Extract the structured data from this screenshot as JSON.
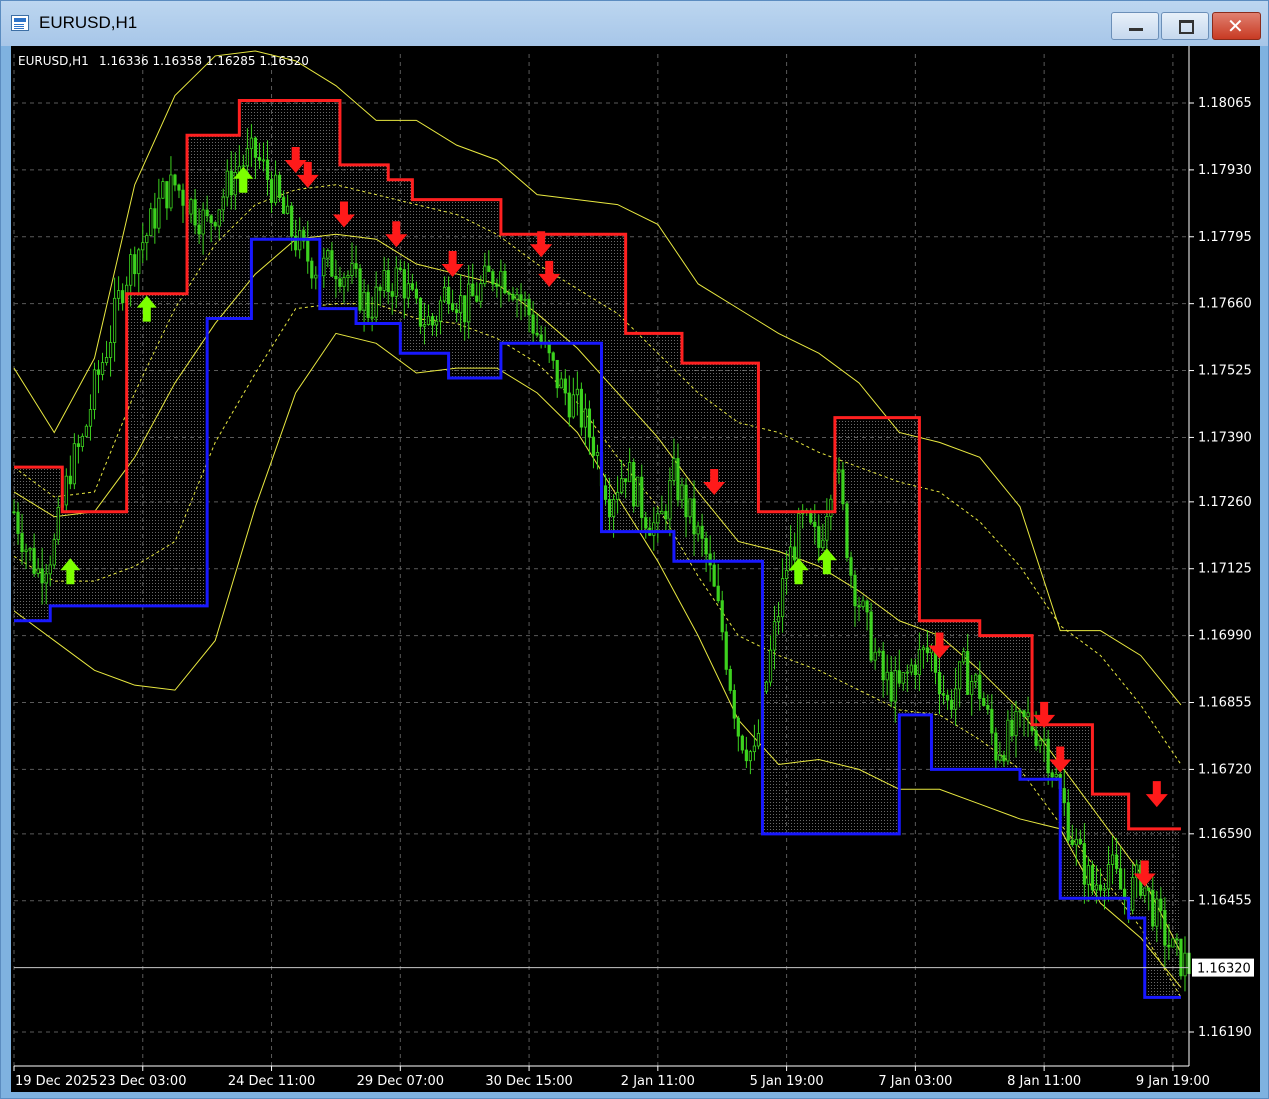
{
  "window": {
    "title": "EURUSD,H1",
    "icons": {
      "app": "chart-app-icon",
      "minimize": "minimize-icon",
      "maximize": "maximize-icon",
      "close": "close-icon"
    }
  },
  "chart_data": {
    "type": "candlestick",
    "symbol_label": "EURUSD,H1",
    "ohlc_label": "1.16336 1.16358 1.16285 1.16320",
    "ohlc": {
      "open": 1.16336,
      "high": 1.16358,
      "low": 1.16285,
      "close": 1.1632
    },
    "current_price": 1.1632,
    "current_price_label": "1.16320",
    "ylim": [
      1.16125,
      1.1817
    ],
    "y_ticks": [
      {
        "value": 1.18065,
        "label": "1.18065"
      },
      {
        "value": 1.1793,
        "label": "1.17930"
      },
      {
        "value": 1.17795,
        "label": "1.17795"
      },
      {
        "value": 1.1766,
        "label": "1.17660"
      },
      {
        "value": 1.17525,
        "label": "1.17525"
      },
      {
        "value": 1.1739,
        "label": "1.17390"
      },
      {
        "value": 1.1726,
        "label": "1.17260"
      },
      {
        "value": 1.17125,
        "label": "1.17125"
      },
      {
        "value": 1.1699,
        "label": "1.16990"
      },
      {
        "value": 1.16855,
        "label": "1.16855"
      },
      {
        "value": 1.1672,
        "label": "1.16720"
      },
      {
        "value": 1.1659,
        "label": "1.16590"
      },
      {
        "value": 1.16455,
        "label": "1.16455"
      },
      {
        "value": 1.1619,
        "label": "1.16190"
      }
    ],
    "x_ticks": [
      {
        "index": 0,
        "label": "19 Dec 2025"
      },
      {
        "index": 32,
        "label": "23 Dec 03:00"
      },
      {
        "index": 64,
        "label": "24 Dec 11:00"
      },
      {
        "index": 96,
        "label": "29 Dec 07:00"
      },
      {
        "index": 128,
        "label": "30 Dec 15:00"
      },
      {
        "index": 160,
        "label": "2 Jan 11:00"
      },
      {
        "index": 192,
        "label": "5 Jan 19:00"
      },
      {
        "index": 224,
        "label": "7 Jan 03:00"
      },
      {
        "index": 256,
        "label": "8 Jan 11:00"
      },
      {
        "index": 288,
        "label": "9 Jan 19:00"
      }
    ],
    "x_range": [
      0,
      292
    ],
    "grid": true,
    "colors": {
      "background": "#000000",
      "grid": "#5a5a5a",
      "candles": "#3cd21e",
      "upper_channel": "#ff2020",
      "lower_channel": "#1818ff",
      "bands": "#e8e840",
      "buy_arrow": "#7cff00",
      "sell_arrow": "#ff1a1a",
      "axis_text": "#ffffff"
    },
    "close_path": [
      [
        0,
        1.1724
      ],
      [
        3,
        1.1717
      ],
      [
        6,
        1.1712
      ],
      [
        10,
        1.1717
      ],
      [
        14,
        1.1733
      ],
      [
        17,
        1.1738
      ],
      [
        20,
        1.1749
      ],
      [
        24,
        1.176
      ],
      [
        27,
        1.177
      ],
      [
        30,
        1.1776
      ],
      [
        33,
        1.178
      ],
      [
        37,
        1.1788
      ],
      [
        40,
        1.179
      ],
      [
        44,
        1.1786
      ],
      [
        48,
        1.1782
      ],
      [
        52,
        1.1788
      ],
      [
        56,
        1.1794
      ],
      [
        60,
        1.1796
      ],
      [
        64,
        1.179
      ],
      [
        68,
        1.1782
      ],
      [
        72,
        1.1776
      ],
      [
        76,
        1.1773
      ],
      [
        80,
        1.1774
      ],
      [
        84,
        1.1771
      ],
      [
        88,
        1.1765
      ],
      [
        92,
        1.1769
      ],
      [
        96,
        1.1772
      ],
      [
        100,
        1.1764
      ],
      [
        104,
        1.1762
      ],
      [
        108,
        1.177
      ],
      [
        112,
        1.1765
      ],
      [
        116,
        1.1769
      ],
      [
        120,
        1.1773
      ],
      [
        124,
        1.177
      ],
      [
        128,
        1.1764
      ],
      [
        132,
        1.1756
      ],
      [
        136,
        1.1749
      ],
      [
        140,
        1.1745
      ],
      [
        144,
        1.1738
      ],
      [
        148,
        1.1727
      ],
      [
        152,
        1.1733
      ],
      [
        156,
        1.1725
      ],
      [
        160,
        1.172
      ],
      [
        164,
        1.1731
      ],
      [
        168,
        1.1723
      ],
      [
        172,
        1.1715
      ],
      [
        176,
        1.17
      ],
      [
        180,
        1.168
      ],
      [
        184,
        1.1674
      ],
      [
        188,
        1.1695
      ],
      [
        192,
        1.1713
      ],
      [
        196,
        1.1722
      ],
      [
        200,
        1.1717
      ],
      [
        204,
        1.1735
      ],
      [
        208,
        1.1712
      ],
      [
        212,
        1.17
      ],
      [
        216,
        1.169
      ],
      [
        220,
        1.1688
      ],
      [
        224,
        1.1694
      ],
      [
        228,
        1.1696
      ],
      [
        232,
        1.1685
      ],
      [
        236,
        1.1692
      ],
      [
        240,
        1.1688
      ],
      [
        244,
        1.1676
      ],
      [
        248,
        1.1679
      ],
      [
        252,
        1.1682
      ],
      [
        256,
        1.1678
      ],
      [
        260,
        1.1667
      ],
      [
        264,
        1.1656
      ],
      [
        268,
        1.1648
      ],
      [
        272,
        1.1653
      ],
      [
        276,
        1.1646
      ],
      [
        280,
        1.165
      ],
      [
        284,
        1.1642
      ],
      [
        288,
        1.1635
      ],
      [
        292,
        1.1632
      ]
    ],
    "upper_channel": [
      [
        0,
        1.1733
      ],
      [
        12,
        1.1733
      ],
      [
        12,
        1.1724
      ],
      [
        28,
        1.1724
      ],
      [
        28,
        1.1768
      ],
      [
        43,
        1.1768
      ],
      [
        43,
        1.18
      ],
      [
        56,
        1.18
      ],
      [
        56,
        1.1807
      ],
      [
        81,
        1.1807
      ],
      [
        81,
        1.1794
      ],
      [
        93,
        1.1794
      ],
      [
        93,
        1.1791
      ],
      [
        99,
        1.1791
      ],
      [
        99,
        1.1787
      ],
      [
        121,
        1.1787
      ],
      [
        121,
        1.178
      ],
      [
        152,
        1.178
      ],
      [
        152,
        1.176
      ],
      [
        166,
        1.176
      ],
      [
        166,
        1.1754
      ],
      [
        185,
        1.1754
      ],
      [
        185,
        1.1724
      ],
      [
        204,
        1.1724
      ],
      [
        204,
        1.1743
      ],
      [
        225,
        1.1743
      ],
      [
        225,
        1.1702
      ],
      [
        240,
        1.1702
      ],
      [
        240,
        1.1699
      ],
      [
        253,
        1.1699
      ],
      [
        253,
        1.1681
      ],
      [
        268,
        1.1681
      ],
      [
        268,
        1.1667
      ],
      [
        277,
        1.1667
      ],
      [
        277,
        1.166
      ],
      [
        290,
        1.166
      ]
    ],
    "lower_channel": [
      [
        0,
        1.1702
      ],
      [
        9,
        1.1702
      ],
      [
        9,
        1.1705
      ],
      [
        48,
        1.1705
      ],
      [
        48,
        1.1763
      ],
      [
        59,
        1.1763
      ],
      [
        59,
        1.1779
      ],
      [
        76,
        1.1779
      ],
      [
        76,
        1.1765
      ],
      [
        85,
        1.1765
      ],
      [
        85,
        1.1762
      ],
      [
        96,
        1.1762
      ],
      [
        96,
        1.1756
      ],
      [
        108,
        1.1756
      ],
      [
        108,
        1.1751
      ],
      [
        121,
        1.1751
      ],
      [
        121,
        1.1758
      ],
      [
        146,
        1.1758
      ],
      [
        146,
        1.172
      ],
      [
        164,
        1.172
      ],
      [
        164,
        1.1714
      ],
      [
        186,
        1.1714
      ],
      [
        186,
        1.1659
      ],
      [
        220,
        1.1659
      ],
      [
        220,
        1.1683
      ],
      [
        228,
        1.1683
      ],
      [
        228,
        1.1672
      ],
      [
        250,
        1.1672
      ],
      [
        250,
        1.167
      ],
      [
        260,
        1.167
      ],
      [
        260,
        1.1646
      ],
      [
        277,
        1.1646
      ],
      [
        277,
        1.1642
      ],
      [
        281,
        1.1642
      ],
      [
        281,
        1.1626
      ],
      [
        290,
        1.1626
      ]
    ],
    "bands": [
      {
        "name": "",
        "style": "solid",
        "points": [
          [
            0,
            1.1753
          ],
          [
            10,
            1.174
          ],
          [
            20,
            1.1755
          ],
          [
            30,
            1.179
          ],
          [
            40,
            1.1808
          ],
          [
            50,
            1.1816
          ],
          [
            60,
            1.1817
          ],
          [
            70,
            1.1815
          ],
          [
            80,
            1.181
          ],
          [
            90,
            1.1803
          ],
          [
            100,
            1.1803
          ],
          [
            110,
            1.1798
          ],
          [
            120,
            1.1795
          ],
          [
            130,
            1.1788
          ],
          [
            140,
            1.1787
          ],
          [
            150,
            1.1786
          ],
          [
            160,
            1.1782
          ],
          [
            170,
            1.177
          ],
          [
            180,
            1.1765
          ],
          [
            190,
            1.176
          ],
          [
            200,
            1.1756
          ],
          [
            210,
            1.175
          ],
          [
            220,
            1.174
          ],
          [
            230,
            1.1738
          ],
          [
            240,
            1.1735
          ],
          [
            250,
            1.1725
          ],
          [
            260,
            1.17
          ],
          [
            270,
            1.17
          ],
          [
            280,
            1.1695
          ],
          [
            290,
            1.1685
          ]
        ]
      },
      {
        "name": "",
        "style": "dashed",
        "points": [
          [
            0,
            1.1733
          ],
          [
            10,
            1.1727
          ],
          [
            20,
            1.1728
          ],
          [
            30,
            1.1748
          ],
          [
            40,
            1.1765
          ],
          [
            50,
            1.1778
          ],
          [
            60,
            1.1786
          ],
          [
            70,
            1.1789
          ],
          [
            80,
            1.179
          ],
          [
            90,
            1.1788
          ],
          [
            100,
            1.1786
          ],
          [
            110,
            1.1784
          ],
          [
            120,
            1.178
          ],
          [
            130,
            1.1774
          ],
          [
            140,
            1.1769
          ],
          [
            150,
            1.1764
          ],
          [
            160,
            1.1756
          ],
          [
            170,
            1.1748
          ],
          [
            180,
            1.1742
          ],
          [
            190,
            1.174
          ],
          [
            200,
            1.1736
          ],
          [
            210,
            1.1733
          ],
          [
            220,
            1.173
          ],
          [
            230,
            1.1728
          ],
          [
            240,
            1.1722
          ],
          [
            250,
            1.1713
          ],
          [
            260,
            1.1701
          ],
          [
            270,
            1.1695
          ],
          [
            280,
            1.1685
          ],
          [
            290,
            1.1673
          ]
        ]
      },
      {
        "name": "",
        "style": "solid",
        "points": [
          [
            0,
            1.1728
          ],
          [
            10,
            1.1723
          ],
          [
            20,
            1.1724
          ],
          [
            30,
            1.1735
          ],
          [
            40,
            1.175
          ],
          [
            50,
            1.1762
          ],
          [
            60,
            1.1772
          ],
          [
            70,
            1.1779
          ],
          [
            80,
            1.178
          ],
          [
            90,
            1.1779
          ],
          [
            100,
            1.1774
          ],
          [
            110,
            1.1772
          ],
          [
            120,
            1.177
          ],
          [
            130,
            1.1764
          ],
          [
            140,
            1.1757
          ],
          [
            150,
            1.1748
          ],
          [
            160,
            1.1739
          ],
          [
            170,
            1.1728
          ],
          [
            180,
            1.1718
          ],
          [
            190,
            1.1716
          ],
          [
            200,
            1.1713
          ],
          [
            210,
            1.1708
          ],
          [
            220,
            1.1702
          ],
          [
            230,
            1.1699
          ],
          [
            240,
            1.1692
          ],
          [
            250,
            1.1684
          ],
          [
            260,
            1.1673
          ],
          [
            270,
            1.1662
          ],
          [
            280,
            1.1651
          ],
          [
            290,
            1.1635
          ]
        ]
      },
      {
        "name": "",
        "style": "dashed",
        "points": [
          [
            0,
            1.1715
          ],
          [
            10,
            1.171
          ],
          [
            20,
            1.171
          ],
          [
            30,
            1.1713
          ],
          [
            40,
            1.1718
          ],
          [
            50,
            1.1738
          ],
          [
            60,
            1.1752
          ],
          [
            70,
            1.1765
          ],
          [
            80,
            1.1766
          ],
          [
            90,
            1.1766
          ],
          [
            100,
            1.1763
          ],
          [
            110,
            1.1762
          ],
          [
            120,
            1.1759
          ],
          [
            130,
            1.1754
          ],
          [
            140,
            1.1746
          ],
          [
            150,
            1.1735
          ],
          [
            160,
            1.1725
          ],
          [
            170,
            1.1711
          ],
          [
            180,
            1.1699
          ],
          [
            190,
            1.1695
          ],
          [
            200,
            1.1692
          ],
          [
            210,
            1.1688
          ],
          [
            220,
            1.1684
          ],
          [
            230,
            1.1683
          ],
          [
            240,
            1.1678
          ],
          [
            250,
            1.1672
          ],
          [
            260,
            1.1661
          ],
          [
            270,
            1.1651
          ],
          [
            280,
            1.164
          ],
          [
            290,
            1.1626
          ]
        ]
      },
      {
        "name": "",
        "style": "solid",
        "points": [
          [
            0,
            1.1704
          ],
          [
            10,
            1.1698
          ],
          [
            20,
            1.1692
          ],
          [
            30,
            1.1689
          ],
          [
            40,
            1.1688
          ],
          [
            50,
            1.1698
          ],
          [
            60,
            1.1725
          ],
          [
            70,
            1.1748
          ],
          [
            80,
            1.176
          ],
          [
            90,
            1.1758
          ],
          [
            100,
            1.1752
          ],
          [
            110,
            1.1753
          ],
          [
            120,
            1.1753
          ],
          [
            130,
            1.1748
          ],
          [
            140,
            1.174
          ],
          [
            150,
            1.1727
          ],
          [
            160,
            1.1714
          ],
          [
            170,
            1.1699
          ],
          [
            180,
            1.1682
          ],
          [
            190,
            1.1673
          ],
          [
            200,
            1.1674
          ],
          [
            210,
            1.1672
          ],
          [
            220,
            1.1668
          ],
          [
            230,
            1.1668
          ],
          [
            240,
            1.1665
          ],
          [
            250,
            1.1662
          ],
          [
            260,
            1.166
          ],
          [
            270,
            1.1645
          ],
          [
            280,
            1.1638
          ],
          [
            290,
            1.1628
          ]
        ]
      }
    ],
    "buy_signals": [
      [
        14,
        1.1712
      ],
      [
        33,
        1.1765
      ],
      [
        57,
        1.1791
      ],
      [
        195,
        1.1712
      ],
      [
        202,
        1.1714
      ]
    ],
    "sell_signals": [
      [
        70,
        1.1795
      ],
      [
        73,
        1.1792
      ],
      [
        82,
        1.1784
      ],
      [
        95,
        1.178
      ],
      [
        109,
        1.1774
      ],
      [
        131,
        1.1778
      ],
      [
        133,
        1.1772
      ],
      [
        174,
        1.173
      ],
      [
        230,
        1.1697
      ],
      [
        256,
        1.1683
      ],
      [
        260,
        1.1674
      ],
      [
        284,
        1.1667
      ],
      [
        281,
        1.1651
      ]
    ]
  }
}
